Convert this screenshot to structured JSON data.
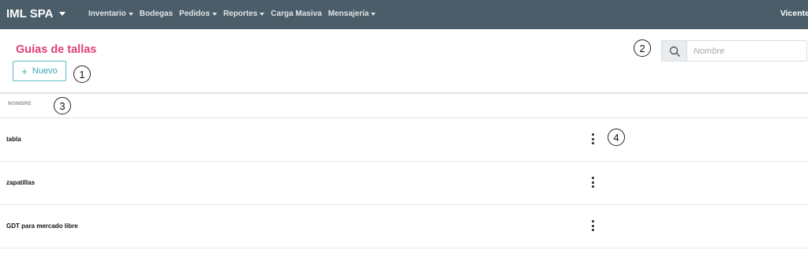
{
  "navbar": {
    "brand": "IML SPA",
    "items": [
      {
        "label": "Inventario",
        "dropdown": true
      },
      {
        "label": "Bodegas",
        "dropdown": false
      },
      {
        "label": "Pedidos",
        "dropdown": true
      },
      {
        "label": "Reportes",
        "dropdown": true
      },
      {
        "label": "Carga Masiva",
        "dropdown": false
      },
      {
        "label": "Mensajería",
        "dropdown": true
      }
    ],
    "user": "Vicente"
  },
  "page": {
    "title": "Guías de tallas",
    "new_button": "Nuevo"
  },
  "search": {
    "placeholder": "Nombre",
    "value": ""
  },
  "table": {
    "column_header": "NOMBRE",
    "rows": [
      {
        "name": "tabla"
      },
      {
        "name": "zapatillas"
      },
      {
        "name": "GDT para mercado libre"
      }
    ]
  },
  "callouts": [
    "1",
    "2",
    "3",
    "4"
  ],
  "colors": {
    "navbar": "#4a5d68",
    "title": "#e0427a",
    "accent": "#3aa6b0"
  },
  "icons": {
    "search": "search-icon",
    "plus": "plus-icon",
    "kebab": "kebab-menu-icon",
    "caret": "caret-down-icon"
  }
}
